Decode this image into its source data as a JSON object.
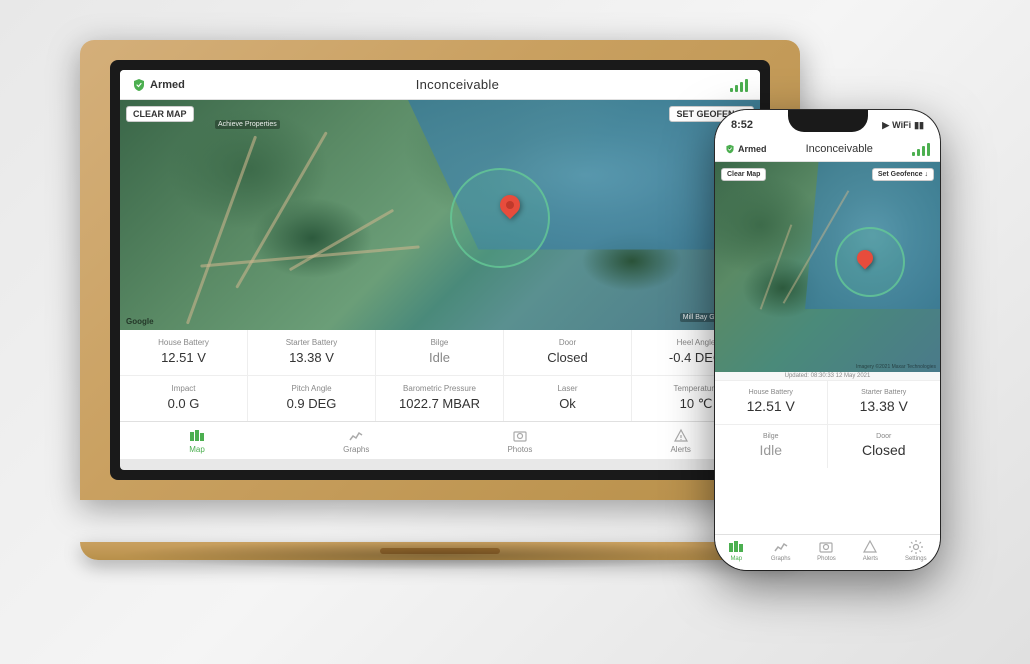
{
  "laptop": {
    "header": {
      "armed_label": "Armed",
      "title": "Inconceivable",
      "signal_bars": [
        4,
        7,
        10,
        13,
        16
      ]
    },
    "map": {
      "clear_map_label": "CLEAR MAP",
      "set_geofence_label": "SET GEOFENCE",
      "achieve_label": "Achieve Properties",
      "millbay_label": "Mill Bay Guesthouse",
      "google_label": "Google"
    },
    "stats_row1": [
      {
        "label": "House Battery",
        "value": "12.51 V"
      },
      {
        "label": "Starter Battery",
        "value": "13.38 V"
      },
      {
        "label": "Bilge",
        "value": "Idle"
      },
      {
        "label": "Door",
        "value": "Closed"
      },
      {
        "label": "Heel Angle",
        "value": "-0.4 DEG"
      }
    ],
    "stats_row2": [
      {
        "label": "Impact",
        "value": "0.0 G"
      },
      {
        "label": "Pitch Angle",
        "value": "0.9 DEG"
      },
      {
        "label": "Barometric Pressure",
        "value": "1022.7 MBAR"
      },
      {
        "label": "Laser",
        "value": "Ok"
      },
      {
        "label": "Temperature",
        "value": "10 ℃"
      }
    ],
    "nav": [
      {
        "label": "Map",
        "active": true
      },
      {
        "label": "Graphs",
        "active": false
      },
      {
        "label": "Photos",
        "active": false
      },
      {
        "label": "Alerts",
        "active": false
      }
    ]
  },
  "phone": {
    "status_bar": {
      "time": "8:52",
      "icons": "▶ WiFi ▮▮▮"
    },
    "header": {
      "armed_label": "Armed",
      "title": "Inconceivable"
    },
    "map": {
      "clear_map_label": "Clear Map",
      "set_geofence_label": "Set Geofence ↓",
      "attribution": "Imagery ©2021 Maxar Technologies",
      "updated": "Updated: 08:30:33 12 May 2021"
    },
    "stats": [
      {
        "label": "House Battery",
        "value": "12.51 V"
      },
      {
        "label": "Starter Battery",
        "value": "13.38 V"
      },
      {
        "label": "Bilge",
        "value": "Idle"
      },
      {
        "label": "Door",
        "value": "Closed"
      }
    ],
    "nav": [
      {
        "label": "Map",
        "active": true
      },
      {
        "label": "Graphs",
        "active": false
      },
      {
        "label": "Photos",
        "active": false
      },
      {
        "label": "Alerts",
        "active": false
      },
      {
        "label": "Settings",
        "active": false
      }
    ]
  },
  "colors": {
    "green": "#4caf50",
    "red": "#e74c3c",
    "bilge_idle": "#999999"
  }
}
